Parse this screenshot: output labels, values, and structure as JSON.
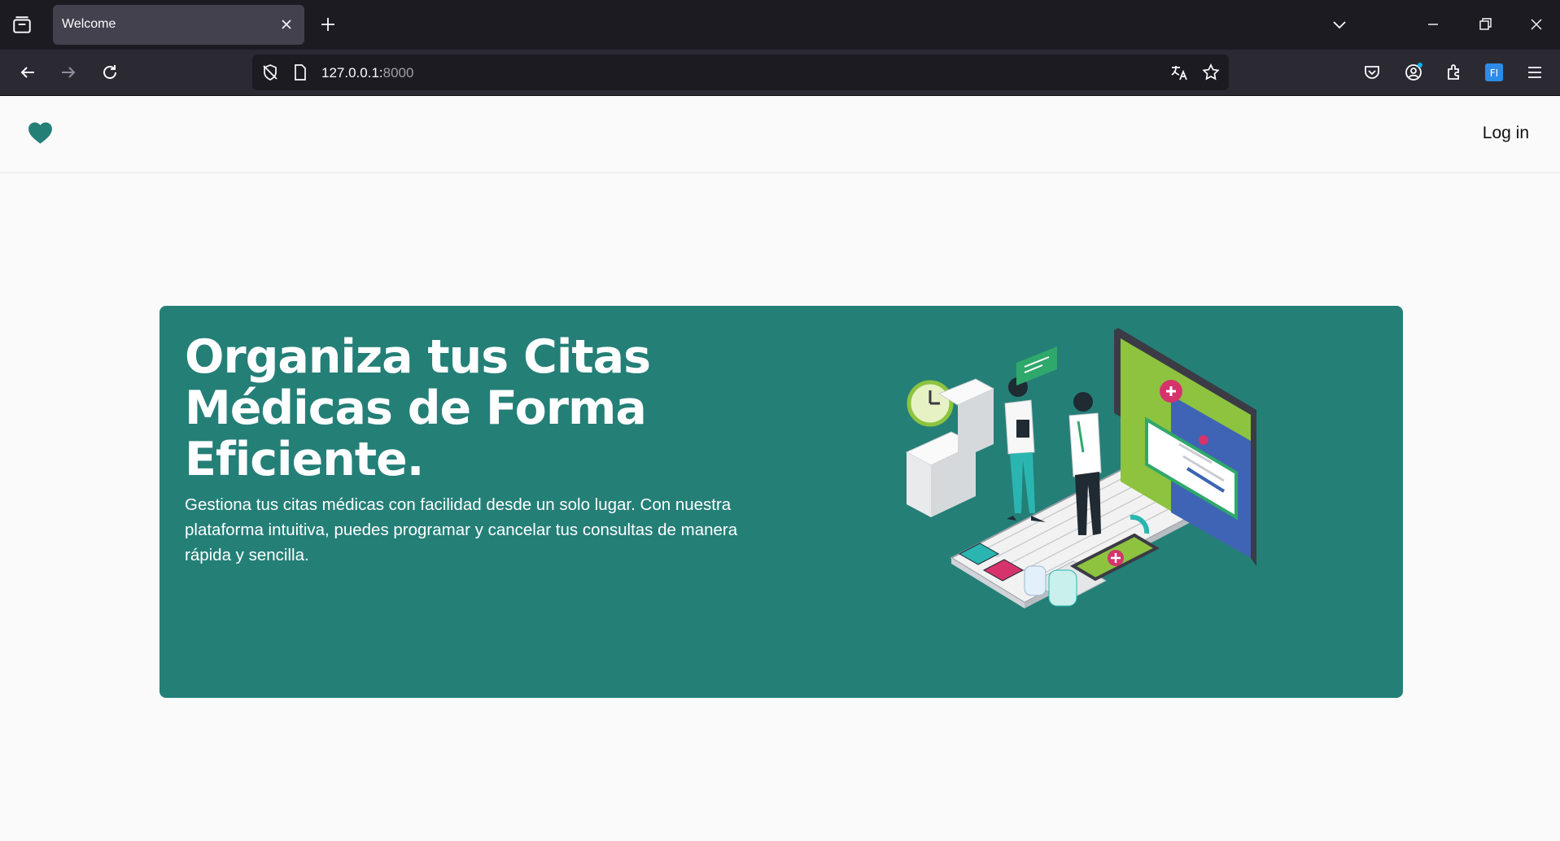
{
  "browser": {
    "tab_title": "Welcome",
    "url_host": "127.0.0.1:",
    "url_port": "8000"
  },
  "site": {
    "login_label": "Log in",
    "logo_icon": "heart-icon",
    "brand_color": "#247f77"
  },
  "hero": {
    "title": "Organiza tus Citas Médicas de Forma Eficiente.",
    "description": "Gestiona tus citas médicas con facilidad desde un solo lugar. Con nuestra plataforma intuitiva, puedes programar y cancelar tus consultas de manera rápida y sencilla.",
    "illustration": "medical-appointment-illustration"
  }
}
